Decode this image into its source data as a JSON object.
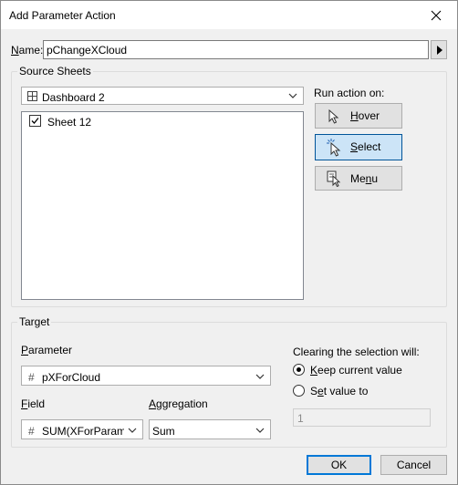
{
  "window": {
    "title": "Add Parameter Action"
  },
  "name_row": {
    "label": "Name:",
    "value": "pChangeXCloud",
    "menu_button": "▸"
  },
  "source_sheets": {
    "group_title": "Source Sheets",
    "dashboard": "Dashboard 2",
    "sheets": [
      {
        "label": "Sheet 12",
        "checked": true
      }
    ]
  },
  "run_action": {
    "label": "Run action on:",
    "hover": "Hover",
    "select": "Select",
    "menu": "Menu",
    "selected": "Select"
  },
  "target": {
    "group_title": "Target",
    "parameter_label": "Parameter",
    "parameter_value": "pXForCloud",
    "field_label": "Field",
    "field_value": "SUM(XForParam...",
    "aggregation_label": "Aggregation",
    "aggregation_value": "Sum",
    "clearing_label": "Clearing the selection will:",
    "keep_label": "Keep current value",
    "set_label": "Set value to",
    "set_value": "1",
    "selected_option": "keep"
  },
  "footer": {
    "ok": "OK",
    "cancel": "Cancel"
  }
}
